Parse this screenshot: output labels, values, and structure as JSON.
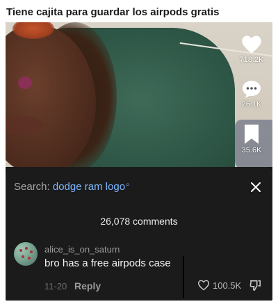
{
  "post": {
    "title": "Tiene cajita para guardar los airpods gratis"
  },
  "video": {
    "actions": {
      "likes": "718.2K",
      "comments": "26.1K",
      "saves": "35.6K"
    }
  },
  "comments_panel": {
    "search_label": "Search:",
    "search_term": "dodge ram logo",
    "count_label": "26,078 comments",
    "comment": {
      "username": "alice_is_on_saturn",
      "text": "bro has a free airpods case",
      "date": "11-20",
      "reply_label": "Reply",
      "likes": "100.5K"
    }
  },
  "colors": {
    "panel_bg": "#1b1b1b",
    "search_link": "#7eb6ff"
  },
  "icons": [
    "heart-icon",
    "comment-dots-icon",
    "bookmark-icon",
    "search-glyph-icon",
    "close-icon",
    "heart-outline-icon",
    "dislike-icon"
  ]
}
